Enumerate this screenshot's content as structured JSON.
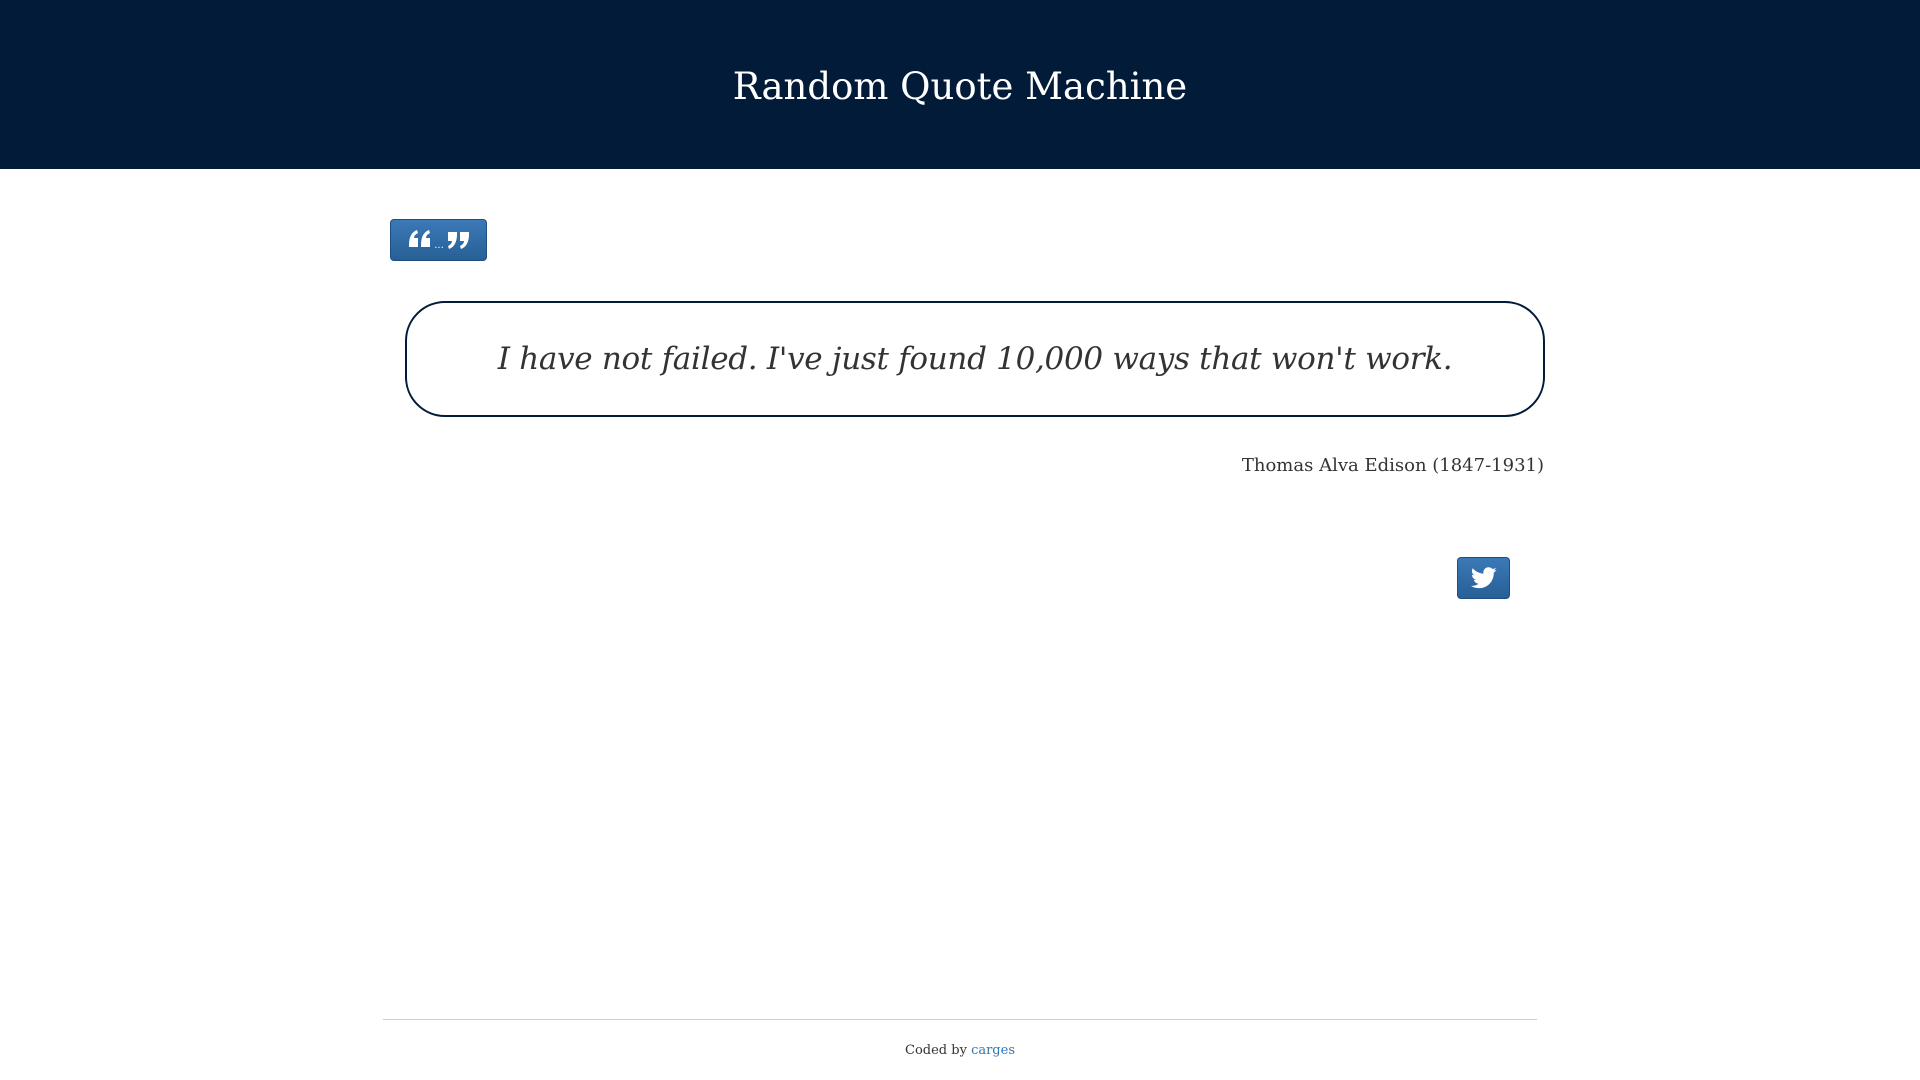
{
  "header": {
    "title": "Random Quote Machine"
  },
  "new_quote_button": {
    "icon": "quote-ellipsis-icon",
    "ellipsis": "..."
  },
  "quote": {
    "text": "I have not failed. I've just found 10,000 ways that won't work.",
    "author": "Thomas Alva Edison (1847-1931)"
  },
  "tweet_button": {
    "icon": "twitter-icon"
  },
  "footer": {
    "prefix": "Coded by",
    "link_text": "carges"
  },
  "colors": {
    "header_bg": "#021b38",
    "button_blue": "#2f6ca8",
    "link_blue": "#3176b8"
  }
}
